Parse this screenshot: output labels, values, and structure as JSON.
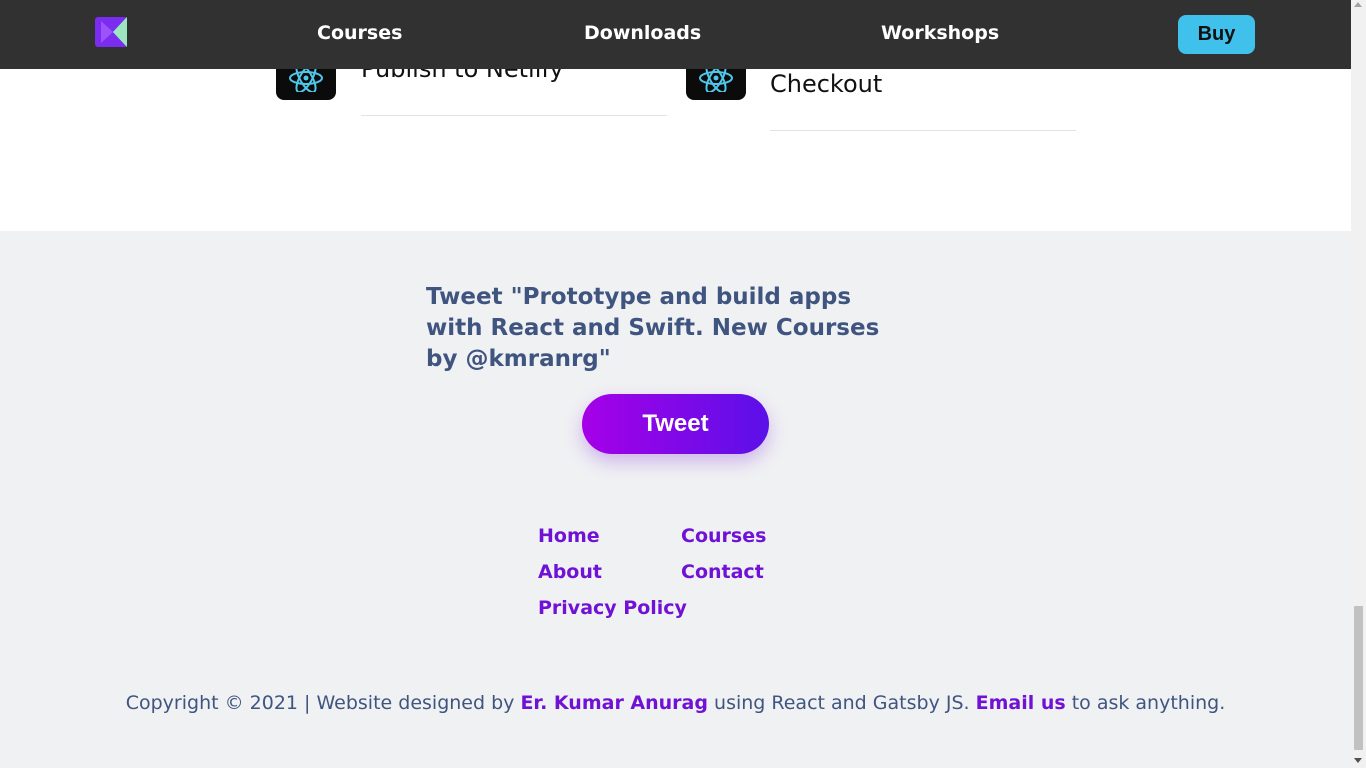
{
  "header": {
    "nav": [
      "Courses",
      "Downloads",
      "Workshops"
    ],
    "buy_label": "Buy",
    "logo_colors": [
      "#7a2cf0",
      "#9be7c0"
    ]
  },
  "cards": [
    {
      "title": "Publish to Netlify",
      "icon": "react-atom-icon"
    },
    {
      "title": "Checkout",
      "icon": "react-atom-icon"
    }
  ],
  "footer": {
    "tweet_text": "Tweet \"Prototype and build apps with React and Swift. New Courses by @kmranrg\"",
    "tweet_button": "Tweet",
    "links": {
      "home": "Home",
      "courses": "Courses",
      "about": "About",
      "contact": "Contact",
      "privacy": "Privacy Policy"
    },
    "copyright": {
      "prefix": "Copyright © 2021 | Website designed by ",
      "author": "Er. Kumar Anurag",
      "middle": " using React and Gatsby JS. ",
      "email": "Email us",
      "suffix": " to ask anything."
    }
  },
  "colors": {
    "header_bg": "#313131",
    "buy_bg": "#3fc1ec",
    "accent": "#7012d6",
    "footer_bg": "#f0f1f3",
    "text": "#3f5580"
  }
}
